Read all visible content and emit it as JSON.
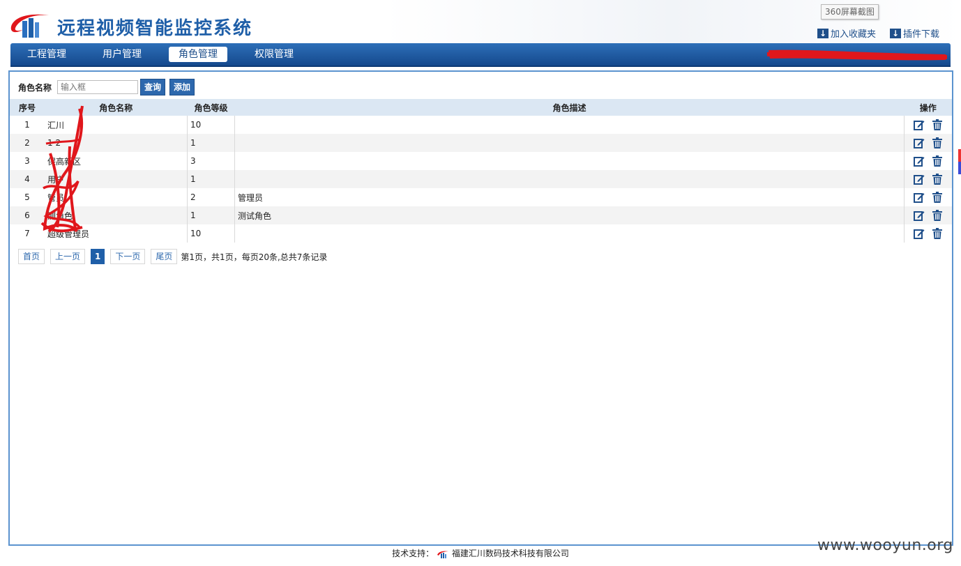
{
  "header": {
    "title": "远程视频智能监控系统",
    "screenshot_tag": "360屏幕截图",
    "add_favorite": "加入收藏夹",
    "plugin_download": "插件下载"
  },
  "nav": {
    "items": [
      {
        "label": "工程管理"
      },
      {
        "label": "用户管理"
      },
      {
        "label": "角色管理"
      },
      {
        "label": "权限管理"
      }
    ],
    "active_index": 2
  },
  "search": {
    "label": "角色名称",
    "placeholder": "输入框",
    "query_button": "查询",
    "add_button": "添加"
  },
  "table": {
    "headers": [
      "序号",
      "角色名称",
      "角色等级",
      "角色描述",
      "操作"
    ],
    "rows": [
      {
        "idx": "1",
        "name": "汇川",
        "level": "10",
        "desc": ""
      },
      {
        "idx": "2",
        "name": "1 2",
        "level": "1",
        "desc": ""
      },
      {
        "idx": "3",
        "name": "保高新区",
        "level": "3",
        "desc": ""
      },
      {
        "idx": "4",
        "name": "用户",
        "level": "1",
        "desc": ""
      },
      {
        "idx": "5",
        "name": "管员",
        "level": "2",
        "desc": "管理员"
      },
      {
        "idx": "6",
        "name": "测角色",
        "level": "1",
        "desc": "测试角色"
      },
      {
        "idx": "7",
        "name": "超级管理员",
        "level": "10",
        "desc": ""
      }
    ]
  },
  "pager": {
    "first": "首页",
    "prev": "上一页",
    "current": "1",
    "next": "下一页",
    "last": "尾页",
    "info": "第1页，共1页，每页20条,总共7条记录"
  },
  "footer": {
    "text": "技术支持：",
    "company": "福建汇川数码技术科技有限公司"
  },
  "watermark": "www.wooyun.org",
  "colors": {
    "brand_blue": "#1f5fa8",
    "nav_blue": "#15498d",
    "header_row": "#dbe7f3",
    "redaction_red": "#e0171c"
  }
}
